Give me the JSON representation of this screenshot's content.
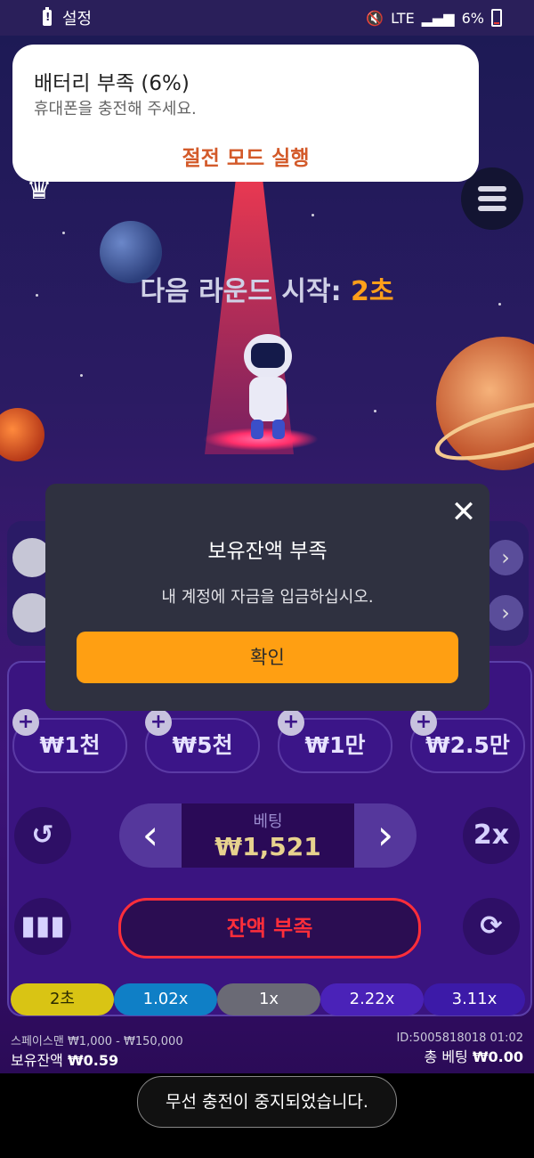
{
  "status_bar": {
    "app_label": "설정",
    "network": "LTE",
    "battery": "6%"
  },
  "notification": {
    "title": "배터리 부족 (6%)",
    "subtitle": "휴대폰을 충전해 주세요.",
    "action": "절전 모드 실행"
  },
  "game": {
    "next_round_label": "다음 라운드 시작:",
    "next_round_seconds": "2초",
    "chips": [
      "₩1천",
      "₩5천",
      "₩1만",
      "₩2.5만"
    ],
    "bet_label": "베팅",
    "bet_value": "₩1,521",
    "double_label": "2x",
    "main_button": "잔액 부족",
    "history": [
      {
        "label": "2초",
        "color": "#d9c414"
      },
      {
        "label": "1.02x",
        "color": "#0f7fc6"
      },
      {
        "label": "1x",
        "color": "#6a6a75"
      },
      {
        "label": "2.22x",
        "color": "#4a22b8"
      },
      {
        "label": "3.11x",
        "color": "#3c1aa8"
      }
    ],
    "game_name": "스페이스맨",
    "limits": "₩1,000 - ₩150,000",
    "balance_label": "보유잔액",
    "balance_value": "₩0.59",
    "round_id": "ID:5005818018 01:02",
    "total_bet_label": "총 베팅",
    "total_bet_value": "₩0.00"
  },
  "dialog": {
    "title": "보유잔액 부족",
    "message": "내 계정에 자금을 입금하십시오.",
    "ok_label": "확인"
  },
  "toast": {
    "message": "무선 충전이 중지되었습니다."
  }
}
